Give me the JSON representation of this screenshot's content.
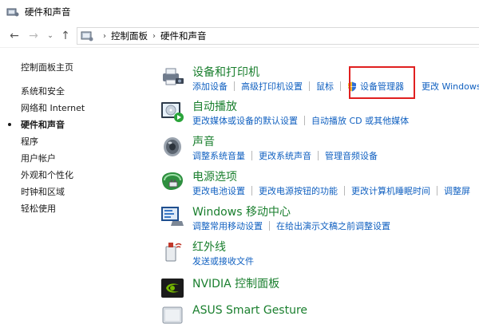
{
  "window": {
    "title": "硬件和声音"
  },
  "address": {
    "crumbs": [
      "控制面板",
      "硬件和声音"
    ]
  },
  "leftnav": {
    "items": [
      "控制面板主页",
      "系统和安全",
      "网络和 Internet",
      "硬件和声音",
      "程序",
      "用户帐户",
      "外观和个性化",
      "时钟和区域",
      "轻松使用"
    ],
    "current": "硬件和声音"
  },
  "categories": [
    {
      "title": "设备和打印机",
      "icon": "printer-camera-icon",
      "links": [
        "添加设备",
        "高级打印机设置",
        "鼠标",
        "设备管理器",
        "更改 Windows"
      ]
    },
    {
      "title": "自动播放",
      "icon": "autoplay-icon",
      "links": [
        "更改媒体或设备的默认设置",
        "自动播放 CD 或其他媒体"
      ]
    },
    {
      "title": "声音",
      "icon": "speaker-icon",
      "links": [
        "调整系统音量",
        "更改系统声音",
        "管理音频设备"
      ]
    },
    {
      "title": "电源选项",
      "icon": "power-options-icon",
      "links": [
        "更改电池设置",
        "更改电源按钮的功能",
        "更改计算机睡眠时间",
        "调整屏"
      ]
    },
    {
      "title": "Windows 移动中心",
      "icon": "mobility-center-icon",
      "links": [
        "调整常用移动设置",
        "在给出演示文稿之前调整设置"
      ]
    },
    {
      "title": "红外线",
      "icon": "infrared-icon",
      "links": [
        "发送或接收文件"
      ]
    },
    {
      "title": "NVIDIA 控制面板",
      "icon": "nvidia-icon",
      "links": []
    },
    {
      "title": "ASUS Smart Gesture",
      "icon": "touchpad-icon",
      "links": []
    }
  ],
  "colors": {
    "category_title": "#1a7f2e",
    "link": "#1060c0",
    "highlight_box": "#e02020"
  }
}
